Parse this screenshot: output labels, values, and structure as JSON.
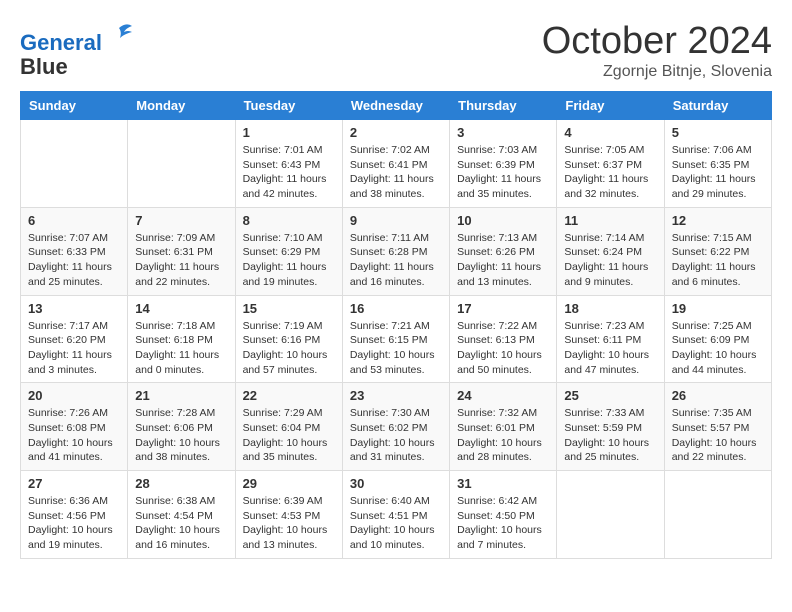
{
  "header": {
    "logo_line1": "General",
    "logo_line2": "Blue",
    "month": "October 2024",
    "location": "Zgornje Bitnje, Slovenia"
  },
  "weekdays": [
    "Sunday",
    "Monday",
    "Tuesday",
    "Wednesday",
    "Thursday",
    "Friday",
    "Saturday"
  ],
  "weeks": [
    [
      {
        "day": "",
        "info": ""
      },
      {
        "day": "",
        "info": ""
      },
      {
        "day": "1",
        "info": "Sunrise: 7:01 AM\nSunset: 6:43 PM\nDaylight: 11 hours and 42 minutes."
      },
      {
        "day": "2",
        "info": "Sunrise: 7:02 AM\nSunset: 6:41 PM\nDaylight: 11 hours and 38 minutes."
      },
      {
        "day": "3",
        "info": "Sunrise: 7:03 AM\nSunset: 6:39 PM\nDaylight: 11 hours and 35 minutes."
      },
      {
        "day": "4",
        "info": "Sunrise: 7:05 AM\nSunset: 6:37 PM\nDaylight: 11 hours and 32 minutes."
      },
      {
        "day": "5",
        "info": "Sunrise: 7:06 AM\nSunset: 6:35 PM\nDaylight: 11 hours and 29 minutes."
      }
    ],
    [
      {
        "day": "6",
        "info": "Sunrise: 7:07 AM\nSunset: 6:33 PM\nDaylight: 11 hours and 25 minutes."
      },
      {
        "day": "7",
        "info": "Sunrise: 7:09 AM\nSunset: 6:31 PM\nDaylight: 11 hours and 22 minutes."
      },
      {
        "day": "8",
        "info": "Sunrise: 7:10 AM\nSunset: 6:29 PM\nDaylight: 11 hours and 19 minutes."
      },
      {
        "day": "9",
        "info": "Sunrise: 7:11 AM\nSunset: 6:28 PM\nDaylight: 11 hours and 16 minutes."
      },
      {
        "day": "10",
        "info": "Sunrise: 7:13 AM\nSunset: 6:26 PM\nDaylight: 11 hours and 13 minutes."
      },
      {
        "day": "11",
        "info": "Sunrise: 7:14 AM\nSunset: 6:24 PM\nDaylight: 11 hours and 9 minutes."
      },
      {
        "day": "12",
        "info": "Sunrise: 7:15 AM\nSunset: 6:22 PM\nDaylight: 11 hours and 6 minutes."
      }
    ],
    [
      {
        "day": "13",
        "info": "Sunrise: 7:17 AM\nSunset: 6:20 PM\nDaylight: 11 hours and 3 minutes."
      },
      {
        "day": "14",
        "info": "Sunrise: 7:18 AM\nSunset: 6:18 PM\nDaylight: 11 hours and 0 minutes."
      },
      {
        "day": "15",
        "info": "Sunrise: 7:19 AM\nSunset: 6:16 PM\nDaylight: 10 hours and 57 minutes."
      },
      {
        "day": "16",
        "info": "Sunrise: 7:21 AM\nSunset: 6:15 PM\nDaylight: 10 hours and 53 minutes."
      },
      {
        "day": "17",
        "info": "Sunrise: 7:22 AM\nSunset: 6:13 PM\nDaylight: 10 hours and 50 minutes."
      },
      {
        "day": "18",
        "info": "Sunrise: 7:23 AM\nSunset: 6:11 PM\nDaylight: 10 hours and 47 minutes."
      },
      {
        "day": "19",
        "info": "Sunrise: 7:25 AM\nSunset: 6:09 PM\nDaylight: 10 hours and 44 minutes."
      }
    ],
    [
      {
        "day": "20",
        "info": "Sunrise: 7:26 AM\nSunset: 6:08 PM\nDaylight: 10 hours and 41 minutes."
      },
      {
        "day": "21",
        "info": "Sunrise: 7:28 AM\nSunset: 6:06 PM\nDaylight: 10 hours and 38 minutes."
      },
      {
        "day": "22",
        "info": "Sunrise: 7:29 AM\nSunset: 6:04 PM\nDaylight: 10 hours and 35 minutes."
      },
      {
        "day": "23",
        "info": "Sunrise: 7:30 AM\nSunset: 6:02 PM\nDaylight: 10 hours and 31 minutes."
      },
      {
        "day": "24",
        "info": "Sunrise: 7:32 AM\nSunset: 6:01 PM\nDaylight: 10 hours and 28 minutes."
      },
      {
        "day": "25",
        "info": "Sunrise: 7:33 AM\nSunset: 5:59 PM\nDaylight: 10 hours and 25 minutes."
      },
      {
        "day": "26",
        "info": "Sunrise: 7:35 AM\nSunset: 5:57 PM\nDaylight: 10 hours and 22 minutes."
      }
    ],
    [
      {
        "day": "27",
        "info": "Sunrise: 6:36 AM\nSunset: 4:56 PM\nDaylight: 10 hours and 19 minutes."
      },
      {
        "day": "28",
        "info": "Sunrise: 6:38 AM\nSunset: 4:54 PM\nDaylight: 10 hours and 16 minutes."
      },
      {
        "day": "29",
        "info": "Sunrise: 6:39 AM\nSunset: 4:53 PM\nDaylight: 10 hours and 13 minutes."
      },
      {
        "day": "30",
        "info": "Sunrise: 6:40 AM\nSunset: 4:51 PM\nDaylight: 10 hours and 10 minutes."
      },
      {
        "day": "31",
        "info": "Sunrise: 6:42 AM\nSunset: 4:50 PM\nDaylight: 10 hours and 7 minutes."
      },
      {
        "day": "",
        "info": ""
      },
      {
        "day": "",
        "info": ""
      }
    ]
  ]
}
